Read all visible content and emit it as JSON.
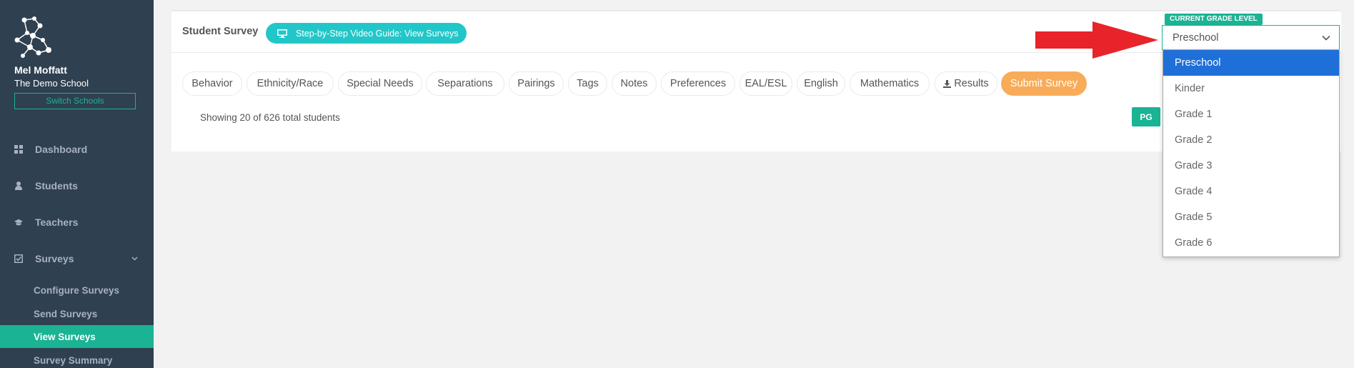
{
  "sidebar": {
    "user_name": "Mel Moffatt",
    "school_name": "The Demo School",
    "switch_label": "Switch Schools",
    "nav": [
      {
        "label": "Dashboard",
        "icon": "dashboard-icon"
      },
      {
        "label": "Students",
        "icon": "user-icon"
      },
      {
        "label": "Teachers",
        "icon": "graduation-cap-icon"
      },
      {
        "label": "Surveys",
        "icon": "check-square-icon"
      }
    ],
    "sub_items": [
      {
        "label": "Configure Surveys"
      },
      {
        "label": "Send Surveys"
      },
      {
        "label": "View Surveys",
        "active": true
      },
      {
        "label": "Survey Summary"
      }
    ]
  },
  "main": {
    "title": "Student Survey",
    "video_button": "Step-by-Step Video Guide: View Surveys",
    "tabs": [
      {
        "label": "Behavior"
      },
      {
        "label": "Ethnicity/Race"
      },
      {
        "label": "Special Needs"
      },
      {
        "label": "Separations"
      },
      {
        "label": "Pairings"
      },
      {
        "label": "Tags"
      },
      {
        "label": "Notes"
      },
      {
        "label": "Preferences"
      },
      {
        "label": "EAL/ESL"
      },
      {
        "label": "English"
      },
      {
        "label": "Mathematics"
      },
      {
        "label": "Results",
        "icon": "download-icon"
      },
      {
        "label": "Submit Survey"
      }
    ],
    "showing_text": "Showing 20 of 626 total students",
    "pg_badge": "PG"
  },
  "grade_selector": {
    "label": "CURRENT GRADE LEVEL",
    "selected": "Preschool",
    "options": [
      "Preschool",
      "Kinder",
      "Grade 1",
      "Grade 2",
      "Grade 3",
      "Grade 4",
      "Grade 5",
      "Grade 6"
    ]
  },
  "colors": {
    "sidebar_bg": "#2f4050",
    "accent": "#1ab394",
    "video_button": "#23c6c8",
    "submit": "#f8ac59",
    "dropdown_selected": "#1f6fd8",
    "arrow": "#e8232a"
  }
}
